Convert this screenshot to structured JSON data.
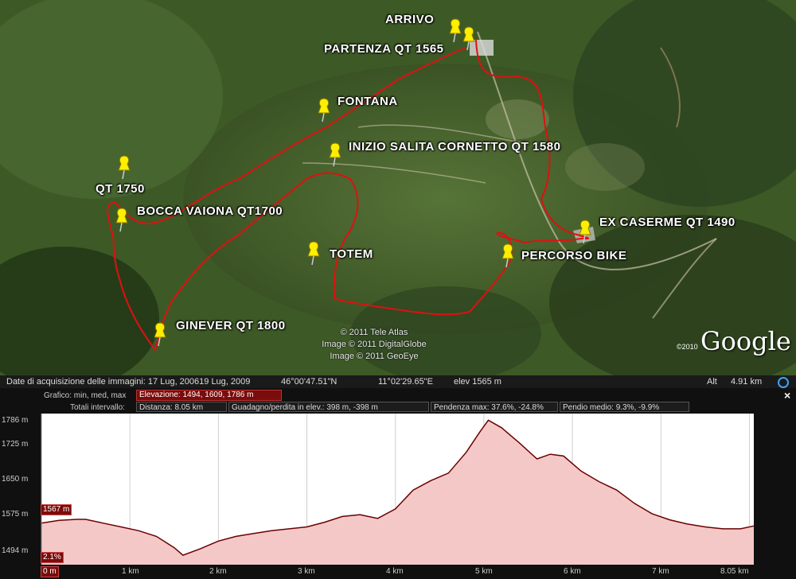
{
  "map": {
    "placemarks": [
      {
        "label": "ARRIVO"
      },
      {
        "label": "PARTENZA QT 1565"
      },
      {
        "label": "FONTANA"
      },
      {
        "label": "INIZIO SALITA CORNETTO QT 1580"
      },
      {
        "label": "QT 1750"
      },
      {
        "label": "BOCCA VAIONA QT1700"
      },
      {
        "label": "TOTEM"
      },
      {
        "label": "GINEVER QT 1800"
      },
      {
        "label": "EX CASERME QT 1490"
      },
      {
        "label": "PERCORSO BIKE"
      }
    ],
    "copyright": [
      "© 2011 Tele Atlas",
      "Image © 2011 DigitalGlobe",
      "Image © 2011 GeoEye"
    ],
    "logo_year": "©2010",
    "logo_text": "Google",
    "track_color": "#e01010"
  },
  "status": {
    "imagery_date": "Date di acquisizione delle immagini: 17 Lug, 200619 Lug, 2009",
    "lat": "46°00'47.51\"N",
    "lon": "11°02'29.65\"E",
    "elev": "elev 1565 m",
    "alt_label": "Alt",
    "alt_value": "4.91 km"
  },
  "profile": {
    "graph_label": "Grafico: min, med, max",
    "elevation_summary": "Elevazione: 1494, 1609, 1786 m",
    "totals_label": "Totali intervallo:",
    "distance": "Distanza: 8.05 km",
    "gain_loss": "Guadagno/perdita in elev.: 398 m, -398 m",
    "max_slope": "Pendenza max: 37.6%, -24.8%",
    "avg_slope": "Pendio medio: 9.3%, -9.9%",
    "cursor_elev": "1567 m",
    "cursor_slope": "2.1%",
    "close": "×"
  },
  "chart_data": {
    "type": "area",
    "xlabel": "",
    "ylabel": "",
    "x_ticks": [
      "0 m",
      "1 km",
      "2 km",
      "3 km",
      "4 km",
      "5 km",
      "6 km",
      "7 km",
      "8.05 km"
    ],
    "y_ticks": [
      "1786 m",
      "1725 m",
      "1650 m",
      "1575 m",
      "1494 m"
    ],
    "ylim": [
      1480,
      1800
    ],
    "xlim": [
      0,
      8.05
    ],
    "series": [
      {
        "x": [
          0,
          0.2,
          0.4,
          0.5,
          0.7,
          0.9,
          1.1,
          1.3,
          1.5,
          1.6,
          1.8,
          2.0,
          2.2,
          2.4,
          2.6,
          2.8,
          3.0,
          3.2,
          3.4,
          3.6,
          3.8,
          4.0,
          4.2,
          4.4,
          4.6,
          4.8,
          4.95,
          5.05,
          5.2,
          5.4,
          5.6,
          5.75,
          5.9,
          6.1,
          6.3,
          6.5,
          6.7,
          6.9,
          7.1,
          7.3,
          7.5,
          7.7,
          7.9,
          8.05
        ],
        "y": [
          1568,
          1574,
          1576,
          1576,
          1568,
          1560,
          1552,
          1540,
          1516,
          1500,
          1514,
          1530,
          1540,
          1546,
          1552,
          1556,
          1560,
          1570,
          1582,
          1586,
          1578,
          1598,
          1638,
          1658,
          1674,
          1718,
          1760,
          1786,
          1770,
          1738,
          1704,
          1714,
          1710,
          1678,
          1656,
          1638,
          1610,
          1588,
          1575,
          1566,
          1560,
          1556,
          1556,
          1562
        ]
      }
    ],
    "fill_color": "#f5c8c8",
    "line_color": "#6b0000"
  }
}
